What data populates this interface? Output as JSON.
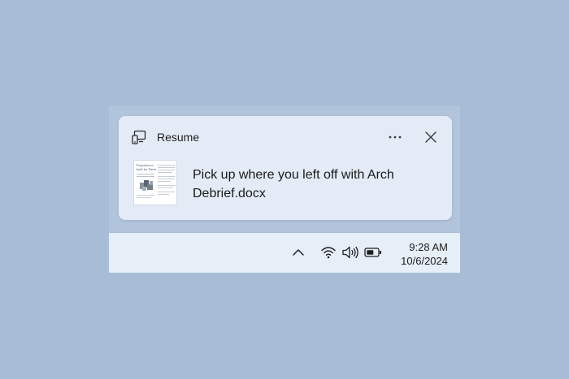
{
  "toast": {
    "app_name": "Resume",
    "app_icon": "devices-icon",
    "message": "Pick up where you left off with Arch Debrief.docx",
    "more_label": "More options",
    "close_label": "Close",
    "thumbnail": {
      "icon": "document-thumbnail",
      "heading_line1": "Experiences",
      "heading_line2": "built for Neon"
    }
  },
  "taskbar": {
    "chevron_icon": "chevron-up-icon",
    "wifi_icon": "wifi-icon",
    "volume_icon": "speaker-icon",
    "battery_icon": "battery-icon",
    "time": "9:28 AM",
    "date": "10/6/2024"
  },
  "colors": {
    "desktop": "#a8bcd6",
    "toast_bg": "#e3ebf6",
    "taskbar_bg": "#e6eef8",
    "text": "#1a1a1a"
  }
}
